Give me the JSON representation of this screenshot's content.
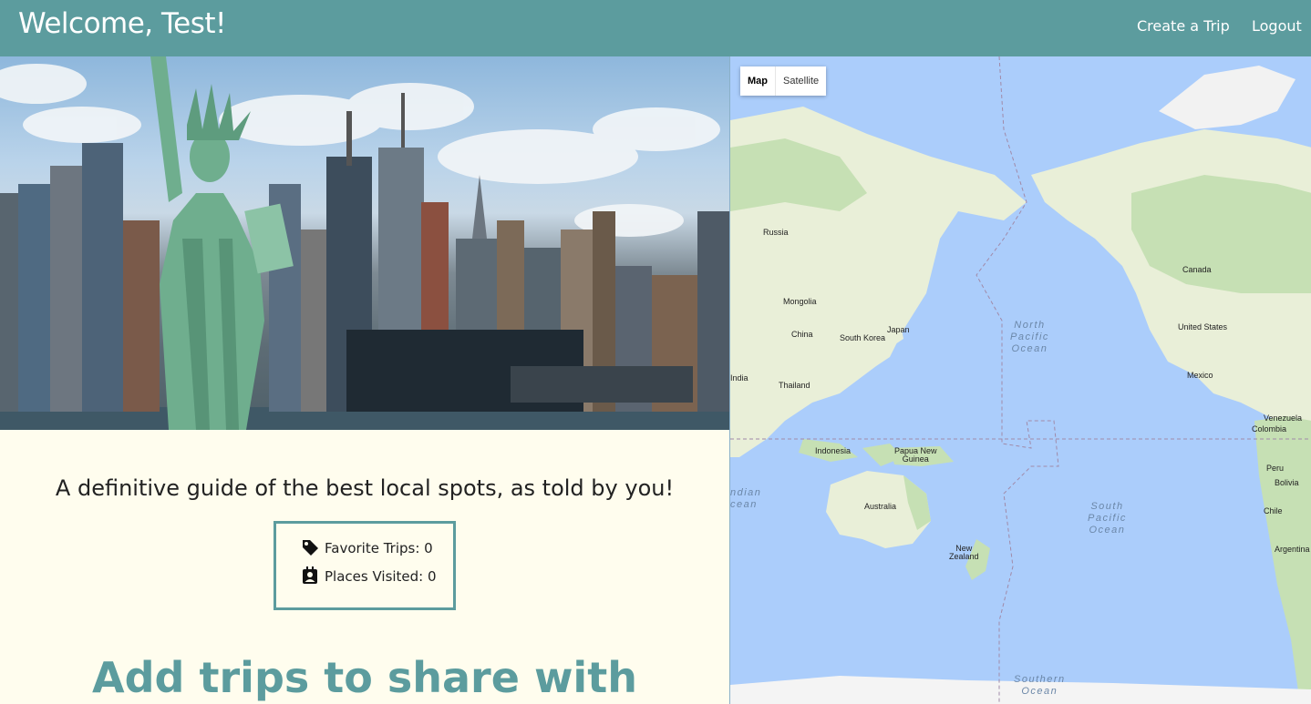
{
  "header": {
    "welcome": "Welcome, Test!",
    "nav": {
      "create_trip": "Create a Trip",
      "logout": "Logout"
    },
    "bg_color": "#5c9c9e"
  },
  "main": {
    "tagline": "A definitive guide of the best local spots, as told by you!",
    "stats": {
      "favorite_trips": "Favorite Trips: 0",
      "places_visited": "Places Visited: 0"
    },
    "cta": "Add trips to share with"
  },
  "map": {
    "type_control": {
      "map": "Map",
      "satellite": "Satellite"
    },
    "countries": {
      "russia": "Russia",
      "mongolia": "Mongolia",
      "china": "China",
      "south_korea": "South Korea",
      "japan": "Japan",
      "india": "India",
      "thailand": "Thailand",
      "indonesia": "Indonesia",
      "papua_new_guinea": "Papua New\nGuinea",
      "australia": "Australia",
      "new_zealand": "New\nZealand",
      "canada": "Canada",
      "united_states": "United States",
      "mexico": "Mexico",
      "venezuela": "Venezuela",
      "colombia": "Colombia",
      "peru": "Peru",
      "bolivia": "Bolivia",
      "chile": "Chile",
      "argentina": "Argentina"
    },
    "oceans": {
      "north_pacific": "North\nPacific\nOcean",
      "south_pacific": "South\nPacific\nOcean",
      "indian": "ndian\ncean",
      "southern": "Southern\nOcean"
    },
    "colors": {
      "water": "#abcdfb",
      "land": "#e9efd8",
      "forest": "#c6e0b4"
    }
  }
}
